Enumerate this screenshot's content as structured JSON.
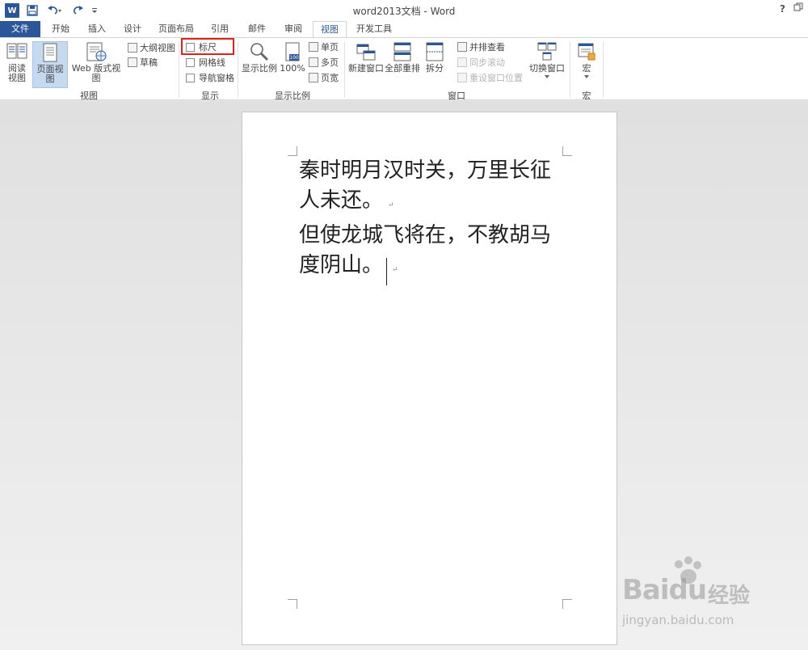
{
  "window": {
    "title": "word2013文档 - Word",
    "help_label": "?",
    "restore_icon": "restore-icon"
  },
  "tabs": [
    {
      "label": "文件"
    },
    {
      "label": "开始"
    },
    {
      "label": "插入"
    },
    {
      "label": "设计"
    },
    {
      "label": "页面布局"
    },
    {
      "label": "引用"
    },
    {
      "label": "邮件"
    },
    {
      "label": "审阅"
    },
    {
      "label": "视图"
    },
    {
      "label": "开发工具"
    }
  ],
  "ribbon": {
    "views": {
      "read_mode": "阅读\n视图",
      "print_layout": "页面视图",
      "web_layout": "Web 版式视图",
      "outline": "大纲视图",
      "draft": "草稿",
      "group_label": "视图"
    },
    "show": {
      "ruler": "标尺",
      "gridlines": "网格线",
      "nav_pane": "导航窗格",
      "group_label": "显示"
    },
    "zoom": {
      "zoom": "显示比例",
      "hundred": "100%",
      "one_page": "单页",
      "multi_page": "多页",
      "page_width": "页宽",
      "group_label": "显示比例"
    },
    "window": {
      "new_window": "新建窗口",
      "arrange_all": "全部重排",
      "split": "拆分",
      "side_by_side": "并排查看",
      "sync_scroll": "同步滚动",
      "reset_pos": "重设窗口位置",
      "switch_windows": "切换窗口",
      "group_label": "窗口"
    },
    "macros": {
      "macros": "宏",
      "group_label": "宏"
    }
  },
  "document": {
    "line1": "秦时明月汉时关，万里长征",
    "line2": "人未还。",
    "line3": "但使龙城飞将在，不教胡马",
    "line4": "度阴山。",
    "para_mark": "↵"
  },
  "watermark": {
    "brand": "Bai",
    "brand_suffix": "du",
    "cn": "经验",
    "url": "jingyan.baidu.com"
  },
  "colors": {
    "accent": "#2b579a",
    "highlight": "#e0221f"
  }
}
